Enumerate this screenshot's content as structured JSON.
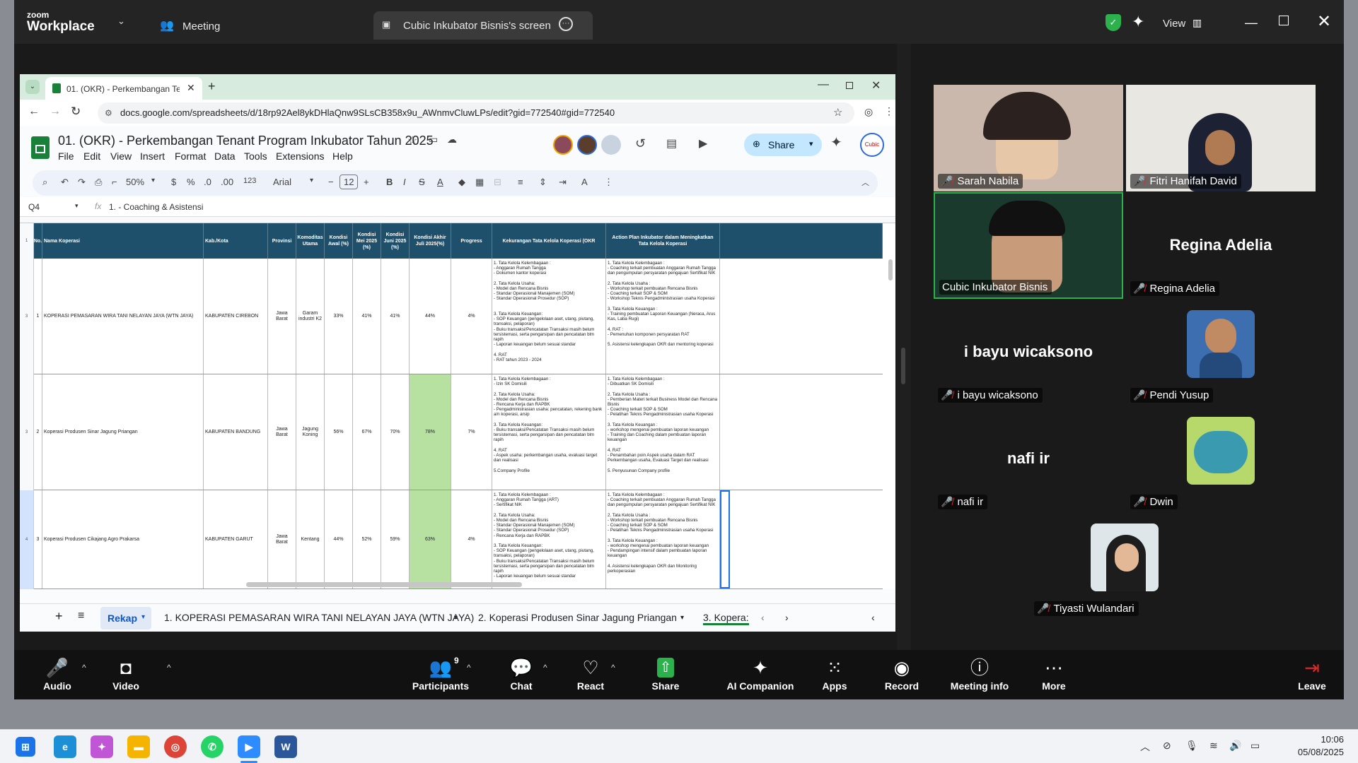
{
  "zoom": {
    "brand_top": "zoom",
    "brand_bottom": "Workplace",
    "meeting_label": "Meeting",
    "share_tab": "Cubic Inkubator Bisnis's screen",
    "view_label": "View",
    "toolbar": {
      "audio": "Audio",
      "video": "Video",
      "participants": "Participants",
      "participants_count": "9",
      "chat": "Chat",
      "react": "React",
      "share": "Share",
      "ai": "AI Companion",
      "apps": "Apps",
      "record": "Record",
      "info": "Meeting info",
      "more": "More",
      "leave": "Leave"
    },
    "participants": [
      {
        "name": "Sarah Nabila"
      },
      {
        "name": "Fitri Hanifah David"
      },
      {
        "name": "Cubic Inkubator Bisnis"
      },
      {
        "name": "Regina Adelia",
        "big": "Regina Adelia"
      },
      {
        "name": "i bayu wicaksono",
        "big": "i bayu wicaksono"
      },
      {
        "name": "Pendi Yusup"
      },
      {
        "name": "nafi ir",
        "big": "nafi ir"
      },
      {
        "name": "Dwin"
      },
      {
        "name": "Tiyasti Wulandari"
      }
    ],
    "colors": {
      "accent_green": "#2bb24c",
      "mic_muted": "#e02828"
    }
  },
  "chrome": {
    "tab_title": "01. (OKR) - Perkembangan Tena",
    "url": "docs.google.com/spreadsheets/d/18rp92Ael8ykDHlaQnw9SLsCB358x9u_AWnmvCluwLPs/edit?gid=772540#gid=772540"
  },
  "sheets": {
    "title": "01. (OKR) - Perkembangan Tenant Program Inkubator Tahun 2025",
    "menu": [
      "File",
      "Edit",
      "View",
      "Insert",
      "Format",
      "Data",
      "Tools",
      "Extensions",
      "Help"
    ],
    "share": "Share",
    "toolbar": {
      "zoom": "50%",
      "currency": "$",
      "percent": "%",
      "dec_less": ".0",
      "dec_more": ".00",
      "fmt": "123",
      "font": "Arial",
      "size": "12"
    },
    "cell_ref": "Q4",
    "formula": "1. - Coaching & Asistensi",
    "header": [
      "No.",
      "Nama Koperasi",
      "Kab./Kota",
      "Provinsi",
      "Komoditas Utama",
      "Kondisi Awal (%)",
      "Kondisi Mei 2025 (%)",
      "Kondisi Juni 2025 (%)",
      "Kondisi Akhir Juli 2025(%)",
      "Progress",
      "Kekurangan Tata Kelola Koperasi (OKR",
      "Action Plan Inkubator dalam Meningkatkan Tata Kelola Koperasi"
    ],
    "rows": [
      {
        "rownum": "3",
        "no": "1",
        "nama": "KOPERASI PEMASARAN WIRA TANI NELAYAN JAYA (WTN JAYA)",
        "kab": "KABUPATEN CIREBON",
        "prov": "Jawa Barat",
        "kom": "Garam industri K2",
        "awal": "33%",
        "mei": "41%",
        "juni": "41%",
        "akhir": "44%",
        "prog": "4%",
        "kurang": "1. Tata Kelola Kelembagaan :\n- Anggaran Rumah Tangga\n- Dokumen kantor koperasi\n\n2. Tata Kelola Usaha:\n- Model dan Rencana Bisnis\n- Standar Operasional Manajemen (SOM)\n- Standar Operasional Prosedur (SOP)\n\n\n3. Tata Kelola Keuangan:\n- SOP Keuangan (pengelolaan aset, utang, piutang, transaksi, pelaporan)\n- Buku transaksi/Pencatatan Transaksi masih belum tersistemasi, serta pengarsipan dan pencatatan blm rapih\n- Laporan keuangan belum sesuai standar\n\n4. RAT\n- RAT tahun 2023 - 2024",
        "plan": "1. Tata Kelola Kelembagaan :\n- Coaching terkait pembuatan Anggaran Rumah Tangga dan pengumpulan persyaratan pengajuan Sertifikat NIK\n\n2. Tata Kelola Usaha :\n- Workshop terkait pembuatan Rencana Bisnis\n- Coaching terkait SOP & SOM\n- Workshop Teknis Pengadministrasian usaha Koperasi\n\n3. Tata Kelola Keuangan :\n- Training pembuatan Laporan Keuangan (Neraca, Arus Kas, Laba Rugi)\n\n4. RAT :\n- Pemenuhan komponen persyaratan RAT\n\n5. Asistensi kelengkapan OKR dan mentoring koperasi"
      },
      {
        "rownum": "3",
        "no": "2",
        "nama": "Koperasi Produsen Sinar Jagung Priangan",
        "kab": "KABUPATEN BANDUNG",
        "prov": "Jawa Barat",
        "kom": "Jagung Koning",
        "awal": "56%",
        "mei": "67%",
        "juni": "70%",
        "akhir": "78%",
        "prog": "7%",
        "kurang": "1. Tata Kelola Kelembagaan :\n- Izin SK Domisili\n\n2. Tata Kelola Usaha:\n- Model dan Rencana Bisnis\n- Rencana Kerja dan RAPBK\n- Pengadministrasian usaha: pencatatan, rekening bank a/n koperasi, arsip\n\n3. Tata Kelola Keuangan:\n- Buku transaksi/Pencatatan Transaksi masih belum tersistemasi, serta pengarsipan dan pencatatan blm rapih\n\n4. RAT\n- Aspek usaha: perkembangan usaha, evaluasi target dan realisasi\n\n5.Company Profile",
        "plan": "1. Tata Kelola Kelembagaan :\n- Dibuatkan SK Domisili\n\n2. Tata Kelola Usaha :\n- Pemberian Materi terkait Business Model dan Rencana Bisnis\n- Coaching terkait SOP & SOM\n- Pelatihan Teknis Pengadministrasian usaha Koperasi\n\n3. Tata Kelola Keuangan :\n- workshop mengenai pembuatan laporan keuangan\n- Training dan Coaching dalam pembuatan laporan keuangan\n\n4. RAT\n- Penambahan poin Aspek usaha dalam RAT Perkembangan usaha, Evaluasi Target dan realisasi\n\n5. Penyusunan Company profile"
      },
      {
        "rownum": "4",
        "no": "3",
        "nama": "Koperasi Produsen Cikajang Agro Prakarsa",
        "kab": "KABUPATEN GARUT",
        "prov": "Jawa Barat",
        "kom": "Kentang",
        "awal": "44%",
        "mei": "52%",
        "juni": "59%",
        "akhir": "63%",
        "prog": "4%",
        "kurang": "1. Tata Kelola Kelembagaan :\n- Anggaran Rumah Tangga (ART)\n- Sertifikat NIK\n\n2. Tata Kelola Usaha:\n- Model dan Rencana Bisnis\n- Standar Operasional Manajemen (SOM)\n- Standar Operasional Prosedur (SOP)\n- Rencana Kerja dan RAPBK\n\n3. Tata Kelola Keuangan:\n- SOP Keuangan (pengelolaan aset, utang, piutang, transaksi, pelaporan)\n- Buku transaksi/Pencatatan Transaksi masih belum tersistemasi, serta pengarsipan dan pencatatan blm rapih\n- Laporan keuangan belum sesuai standar",
        "plan": "1. Tata Kelola Kelembagaan :\n- Coaching terkait pembuatan Anggaran Rumah Tangga dan pengumpulan persyaratan pengajuan Sertifikat NIK\n\n2. Tata Kelola Usaha :\n- Workshop terkait pembuatan Rencana Bisnis\n- Coaching terkait SOP & SOM\n- Pelatihan Teknis Pengadministrasian usaha Koperasi\n\n3. Tata Kelola Keuangan :\n- workshop mengenai pembuatan laporan keuangan\n- Pendampingan intensif dalam pembuatan laporan keuangan\n\n4. Asistensi kelengkapan OKR dan Monitoring perkoperasian"
      }
    ],
    "sheet_tabs": [
      "Rekap",
      "1. KOPERASI PEMASARAN WIRA TANI NELAYAN JAYA (WTN JAYA)",
      "2. Koperasi Produsen Sinar Jagung Priangan",
      "3. Kopera:"
    ]
  },
  "taskbar": {
    "time": "10:06",
    "date": "05/08/2025"
  }
}
